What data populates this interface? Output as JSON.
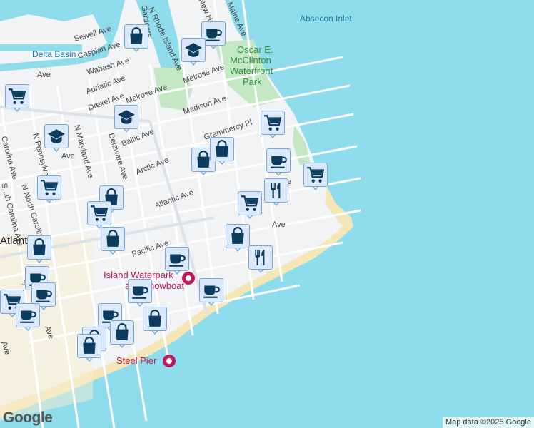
{
  "map": {
    "water_labels": {
      "inlet": "Absecon Inlet",
      "basin": "Delta Basin"
    },
    "park_label": [
      "Oscar E.",
      "McClinton",
      "Waterfront",
      "Park"
    ],
    "city_label": "Atlantic Ci",
    "streets": {
      "maine": "Maine Ave",
      "new_hampshire": "New Hamp",
      "n_rhode_island": "N Rhode Island Ave",
      "gardners": "Gardners",
      "sewell": "Sewell Ave",
      "caspian": "Caspian Ave",
      "wabash": "Wabash Ave",
      "adriatic": "Adriatic Ave",
      "drexel": "Drexel Ave",
      "melrose1": "Melrose Ave",
      "melrose2": "Melrose Ave",
      "madison": "Madison Ave",
      "gramercy": "Grammercy Pl",
      "baltic": "Baltic Ave",
      "arctic": "Arctic Ave",
      "atlantic": "Atlantic Ave",
      "pacific": "Pacific Ave",
      "delaware": "Delaware Ave",
      "n_maryland": "N Maryland Ave",
      "n_pennsylvania": "N Pennsylvania Ave",
      "n_north_carolina": "N North Carolina Ave",
      "n_south_carolina": "S...th Carolina Ave",
      "carolina": "Carolina Ave",
      "ave_frag": "Ave",
      "ave_frag2": "Ave",
      "ave_frag3": "Ave",
      "ave_frag4": "Ave",
      "ave_frag5": "Ave",
      "j_ave": "J",
      "e_ave": "e"
    },
    "pois": {
      "island_waterpark": [
        "Island Waterpark",
        "and Showboat"
      ],
      "steel_pier": "Steel Pier"
    },
    "markers": [
      {
        "type": "shopping-bag",
        "name": "shopping-bag-marker"
      },
      {
        "type": "coffee-cup",
        "name": "coffee-marker"
      },
      {
        "type": "graduation-cap",
        "name": "school-marker"
      },
      {
        "type": "shopping-cart",
        "name": "grocery-marker"
      },
      {
        "type": "graduation-cap",
        "name": "school-marker"
      },
      {
        "type": "shopping-cart",
        "name": "grocery-marker"
      },
      {
        "type": "graduation-cap",
        "name": "school-marker"
      },
      {
        "type": "shopping-bag",
        "name": "shopping-bag-marker"
      },
      {
        "type": "shopping-bag",
        "name": "shopping-bag-marker"
      },
      {
        "type": "coffee-cup",
        "name": "coffee-marker"
      },
      {
        "type": "shopping-cart",
        "name": "grocery-marker"
      },
      {
        "type": "shopping-cart",
        "name": "grocery-marker"
      },
      {
        "type": "fork-knife",
        "name": "restaurant-marker"
      },
      {
        "type": "shopping-cart",
        "name": "grocery-marker"
      },
      {
        "type": "shopping-bag",
        "name": "shopping-bag-marker"
      },
      {
        "type": "shopping-cart",
        "name": "grocery-marker"
      },
      {
        "type": "shopping-bag",
        "name": "shopping-bag-marker"
      },
      {
        "type": "shopping-bag",
        "name": "shopping-bag-marker"
      },
      {
        "type": "shopping-bag",
        "name": "shopping-bag-marker"
      },
      {
        "type": "fork-knife",
        "name": "restaurant-marker"
      },
      {
        "type": "coffee-cup",
        "name": "coffee-marker"
      },
      {
        "type": "coffee-cup",
        "name": "coffee-marker"
      },
      {
        "type": "coffee-cup",
        "name": "coffee-marker"
      },
      {
        "type": "coffee-cup",
        "name": "coffee-marker"
      },
      {
        "type": "shopping-cart",
        "name": "grocery-marker"
      },
      {
        "type": "coffee-cup",
        "name": "coffee-marker"
      },
      {
        "type": "coffee-cup",
        "name": "coffee-marker"
      },
      {
        "type": "coffee-cup",
        "name": "coffee-marker"
      },
      {
        "type": "shopping-bag",
        "name": "shopping-bag-marker"
      },
      {
        "type": "shopping-bag",
        "name": "shopping-bag-marker"
      },
      {
        "type": "shopping-bag",
        "name": "shopping-bag-marker"
      },
      {
        "type": "shopping-bag",
        "name": "shopping-bag-marker"
      }
    ],
    "colors": {
      "water": "#8fdcec",
      "land": "#f2f3f5",
      "beach": "#f5e6b8",
      "park": "#c4e8c4",
      "marker_fill": "#dbe9fb",
      "marker_icon": "#0b3b5e"
    }
  },
  "logo": "Google",
  "attribution": "Map data ©2025 Google"
}
